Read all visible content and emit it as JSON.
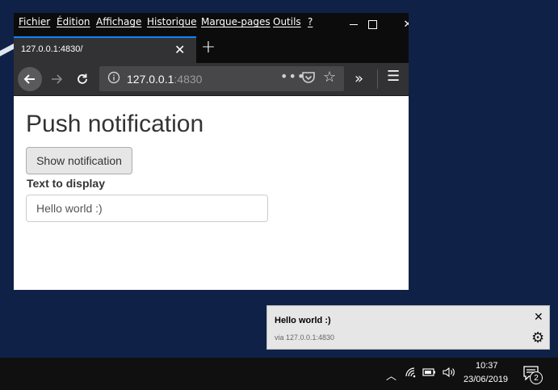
{
  "browser": {
    "menu": [
      "Fichier",
      "Édition",
      "Affichage",
      "Historique",
      "Marque-pages",
      "Outils",
      "?"
    ],
    "tab_title": "127.0.0.1:4830/",
    "url_host": "127.0.0.1",
    "url_port": ":4830"
  },
  "page": {
    "heading": "Push notification",
    "button_label": "Show notification",
    "field_label": "Text to display",
    "input_value": "Hello world :)"
  },
  "notification": {
    "title": "Hello world :)",
    "source": "via 127.0.0.1:4830"
  },
  "taskbar": {
    "time": "10:37",
    "date": "23/06/2019",
    "notification_count": "2"
  },
  "colors": {
    "desktop": "#0f2147",
    "tab_accent": "#0a84ff",
    "toolbar": "#323234"
  },
  "icons": [
    "back-arrow-icon",
    "forward-arrow-icon",
    "reload-icon",
    "info-icon",
    "page-actions-icon",
    "pocket-icon",
    "star-icon",
    "overflow-icon",
    "hamburger-menu-icon",
    "close-icon",
    "gear-icon",
    "chevron-up-icon",
    "wifi-icon",
    "battery-icon",
    "volume-icon",
    "action-center-icon"
  ]
}
